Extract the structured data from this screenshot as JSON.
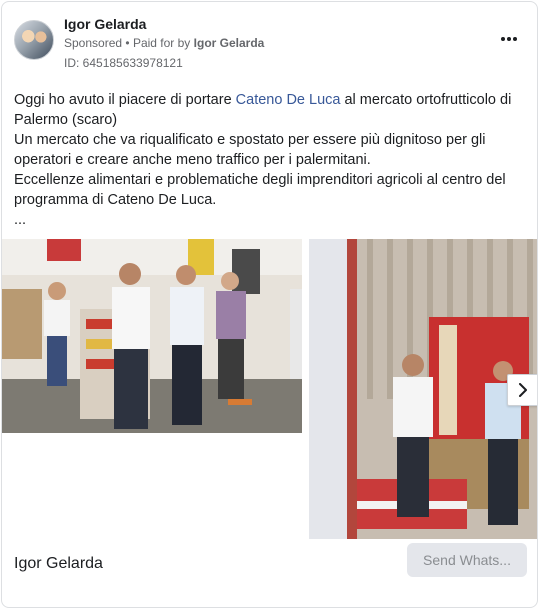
{
  "post": {
    "author": "Igor Gelarda",
    "sponsored": "Sponsored",
    "separator": "•",
    "paid_for_by_prefix": "Paid for by",
    "paid_for_by_name": "Igor Gelarda",
    "ad_id": "ID: 645185633978121",
    "text": {
      "line1_before_link": "Oggi ho avuto il piacere di portare ",
      "link_name": "Cateno De Luca",
      "line1_after_link": " al mercato ortofrutticolo di Palermo (scaro)",
      "paragraph2": "Un mercato che va riqualificato e spostato per essere più dignitoso per gli operatori e creare anche meno traffico per i palermitani.",
      "paragraph3": "Eccellenze alimentari e problematiche degli imprenditori agricoli al centro del programma di Cateno De Luca.",
      "ellipsis": "..."
    }
  },
  "footer": {
    "page_name": "Igor Gelarda",
    "cta_label": "Send Whats..."
  },
  "icons": {
    "more": "more-options-icon",
    "next": "chevron-right-icon"
  }
}
